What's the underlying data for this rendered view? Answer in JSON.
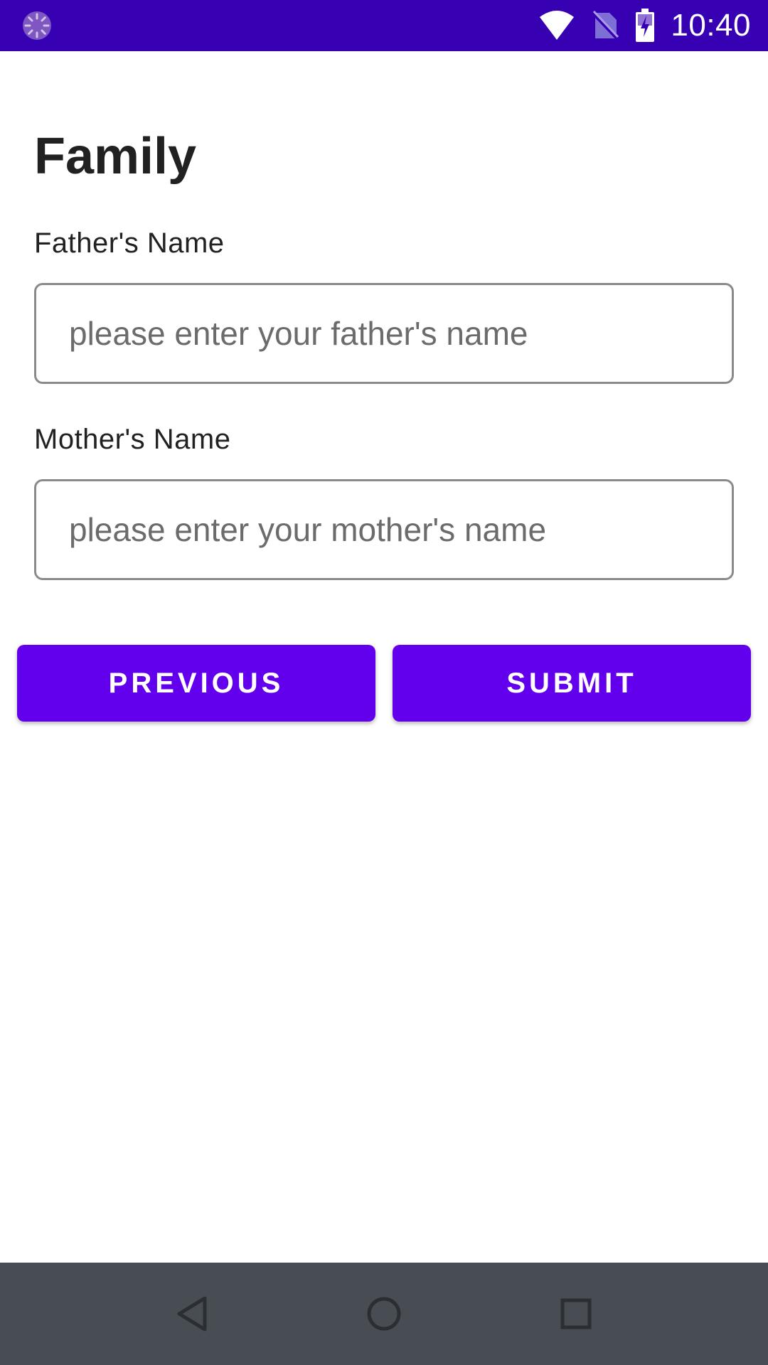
{
  "status_bar": {
    "time": "10:40",
    "app_icon": "loading-spinner-icon",
    "icons": [
      "wifi-icon",
      "no-sim-icon",
      "battery-charging-icon"
    ],
    "color": "#3700b3"
  },
  "form": {
    "title": "Family",
    "father": {
      "label": "Father's Name",
      "placeholder": "please enter your father's name",
      "value": ""
    },
    "mother": {
      "label": "Mother's Name",
      "placeholder": "please enter your mother's name",
      "value": ""
    }
  },
  "actions": {
    "previous_label": "PREVIOUS",
    "submit_label": "SUBMIT",
    "color": "#6200ee"
  },
  "nav_bar": {
    "icons": [
      "back-icon",
      "home-icon",
      "recents-icon"
    ]
  }
}
